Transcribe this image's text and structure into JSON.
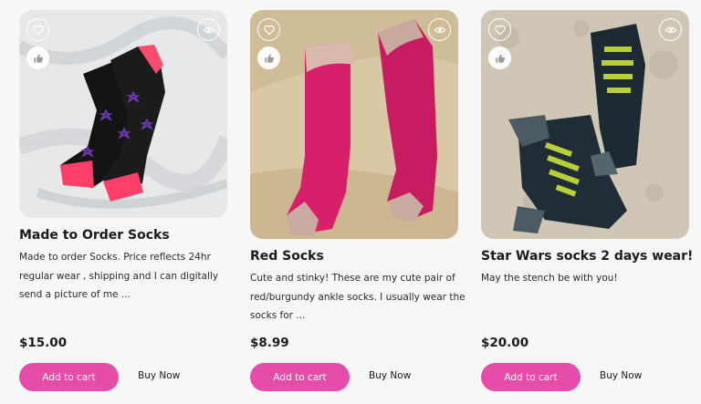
{
  "products": [
    {
      "title": "Made to Order Socks",
      "description": "Made to order Socks. Price reflects 24hr regular wear , shipping and  I can digitally send a picture of me ...",
      "price": "$15.00",
      "add_to_cart": "Add to cart",
      "buy_now": "Buy Now",
      "icons": [
        "heart-icon",
        "thumbs-up-icon",
        "eye-icon"
      ]
    },
    {
      "title": "Red Socks",
      "description": "Cute and stinky! These are my cute pair of red/burgundy ankle socks. I usually wear the socks for ...",
      "price": "$8.99",
      "add_to_cart": "Add to cart",
      "buy_now": "Buy Now",
      "icons": [
        "heart-icon",
        "thumbs-up-icon",
        "eye-icon"
      ]
    },
    {
      "title": "Star Wars socks 2 days wear!",
      "description": "May the stench be with you!",
      "price": "$20.00",
      "add_to_cart": "Add to cart",
      "buy_now": "Buy Now",
      "icons": [
        "heart-icon",
        "thumbs-up-icon",
        "eye-icon"
      ]
    }
  ],
  "colors": {
    "accent": "#e64ca9",
    "background": "#f7f7f7",
    "text": "#1b1b1b"
  }
}
